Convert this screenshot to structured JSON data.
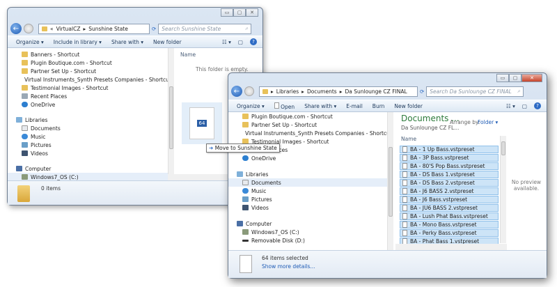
{
  "window1": {
    "path": [
      "«",
      "VirtualCZ",
      "Sunshine State"
    ],
    "search_placeholder": "Search Sunshine State",
    "toolbar": [
      "Organize ▾",
      "Include in library ▾",
      "Share with ▾",
      "New folder"
    ],
    "nav": [
      "Banners - Shortcut",
      "Plugin Boutique.com - Shortcut",
      "Partner Set Up - Shortcut",
      "Virtual Instruments_Synth Presets Companies - Shortcut",
      "Testimonial Images - Shortcut",
      "Recent Places",
      "OneDrive",
      "Libraries",
      "Documents",
      "Music",
      "Pictures",
      "Videos",
      "Computer",
      "Windows7_OS (C:)"
    ],
    "column_name": "Name",
    "empty_text": "This folder is empty.",
    "drag_count": "64",
    "drag_tooltip": "Move to Sunshine State",
    "status": "0 items"
  },
  "window2": {
    "path": [
      "Libraries",
      "Documents",
      "Da Sunlounge CZ FINAL"
    ],
    "search_placeholder": "Search Da Sunlounge CZ FINAL",
    "toolbar": [
      "Organize ▾",
      "Open",
      "Share with ▾",
      "E-mail",
      "Burn",
      "New folder"
    ],
    "nav": [
      "Plugin Boutique.com - Shortcut",
      "Partner Set Up - Shortcut",
      "Virtual Instruments_Synth Presets Companies - Shortcut",
      "Testimonial Images - Shortcut",
      "Recent Places",
      "OneDrive",
      "Libraries",
      "Documents",
      "Music",
      "Pictures",
      "Videos",
      "Computer",
      "Windows7_OS (C:)",
      "Removable Disk (D:)"
    ],
    "library_title": "Documents ...",
    "library_sub": "Da Sunlounge CZ FL...",
    "arrange_label": "Arrange by:",
    "arrange_value": "Folder ▾",
    "column_name": "Name",
    "files": [
      "BA - 1 Up Bass.vstpreset",
      "BA - 3P Bass.vstpreset",
      "BA - 80'S Pop Bass.vstpreset",
      "BA - DS Bass 1.vstpreset",
      "BA - DS Bass 2.vstpreset",
      "BA - J6 BASS 2.vstpreset",
      "BA - J6 Bass.vstpreset",
      "BA - JU6 BASS 2.vstpreset",
      "BA - Lush Phat Bass.vstpreset",
      "BA - Mono Bass.vstpreset",
      "BA - Perky Bass.vstpreset",
      "BA - Phat Bass 1.vstpreset"
    ],
    "preview": "No preview available.",
    "status_count": "64 items selected",
    "status_link": "Show more details..."
  },
  "colors": {
    "selection": "#cde4f7",
    "title_green": "#2c7a3a",
    "link": "#1e5bb5"
  }
}
